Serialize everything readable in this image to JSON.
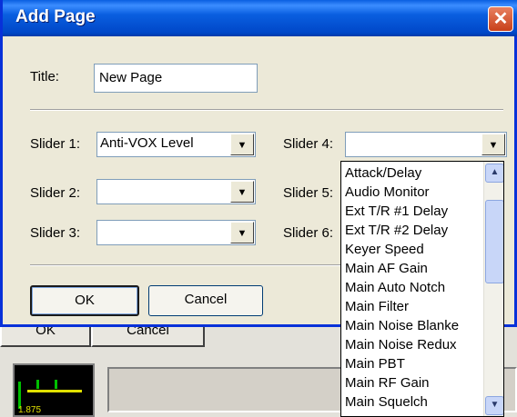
{
  "dialog": {
    "title": "Add Page",
    "close_glyph": "✕",
    "title_label": "Title:",
    "title_value": "New Page",
    "ok_label": "OK",
    "cancel_label": "Cancel"
  },
  "sliders": [
    {
      "label": "Slider 1:",
      "value": "Anti-VOX Level"
    },
    {
      "label": "Slider 2:",
      "value": ""
    },
    {
      "label": "Slider 3:",
      "value": ""
    },
    {
      "label": "Slider 4:",
      "value": ""
    },
    {
      "label": "Slider 5:",
      "value": ""
    },
    {
      "label": "Slider 6:",
      "value": ""
    }
  ],
  "dropdown": {
    "items": [
      "Attack/Delay",
      "Audio Monitor",
      "Ext T/R #1 Delay",
      "Ext T/R #2 Delay",
      "Keyer Speed",
      "Main AF Gain",
      "Main Auto Notch",
      "Main Filter",
      "Main Noise Blanke",
      "Main Noise Redux",
      "Main PBT",
      "Main RF Gain",
      "Main Squelch"
    ]
  },
  "background": {
    "ok_label": "OK",
    "cancel_label": "Cancel",
    "meter_text": "1.875"
  },
  "icons": {
    "dropdown_arrow": "▼",
    "scroll_up": "▲",
    "scroll_down": "▼"
  }
}
